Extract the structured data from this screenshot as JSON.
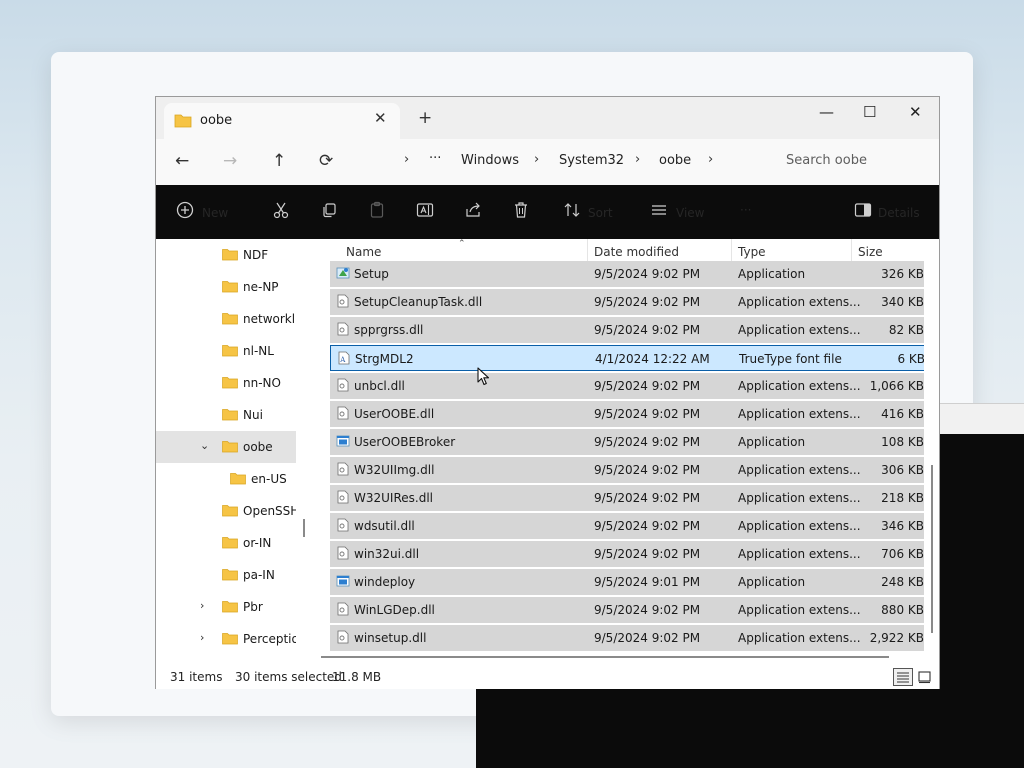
{
  "window": {
    "tab_title": "oobe",
    "tab_close": "✕",
    "new_tab": "+",
    "minimize": "—",
    "maximize": "☐",
    "close": "✕"
  },
  "addressbar": {
    "back": "←",
    "forward": "→",
    "up": "↑",
    "refresh": "⟳",
    "ellipsis": "···",
    "breadcrumbs": [
      "Windows",
      "System32",
      "oobe"
    ],
    "sep": "›",
    "search_placeholder": "Search oobe"
  },
  "toolbar": {
    "new_label": "New",
    "sort_label": "Sort",
    "view_label": "View",
    "more": "···",
    "details_label": "Details"
  },
  "sidebar": {
    "items": [
      {
        "label": "NDF",
        "chevron": "",
        "indent": 1,
        "selected": false
      },
      {
        "label": "ne-NP",
        "chevron": "",
        "indent": 1,
        "selected": false
      },
      {
        "label": "networklist",
        "chevron": "",
        "indent": 1,
        "selected": false
      },
      {
        "label": "nl-NL",
        "chevron": "",
        "indent": 1,
        "selected": false
      },
      {
        "label": "nn-NO",
        "chevron": "",
        "indent": 1,
        "selected": false
      },
      {
        "label": "Nui",
        "chevron": "",
        "indent": 1,
        "selected": false
      },
      {
        "label": "oobe",
        "chevron": "⌄",
        "indent": 1,
        "selected": true
      },
      {
        "label": "en-US",
        "chevron": "",
        "indent": 2,
        "selected": false
      },
      {
        "label": "OpenSSH",
        "chevron": "",
        "indent": 1,
        "selected": false
      },
      {
        "label": "or-IN",
        "chevron": "",
        "indent": 1,
        "selected": false
      },
      {
        "label": "pa-IN",
        "chevron": "",
        "indent": 1,
        "selected": false
      },
      {
        "label": "Pbr",
        "chevron": "›",
        "indent": 1,
        "selected": false
      },
      {
        "label": "Perception",
        "chevron": "›",
        "indent": 1,
        "selected": false
      }
    ]
  },
  "columns": {
    "name": "Name",
    "date": "Date modified",
    "type": "Type",
    "size": "Size"
  },
  "files": [
    {
      "name": "Setup",
      "date": "9/5/2024 9:02 PM",
      "type": "Application",
      "size": "326 KB",
      "icon": "setup-icon",
      "focused": false
    },
    {
      "name": "SetupCleanupTask.dll",
      "date": "9/5/2024 9:02 PM",
      "type": "Application extens...",
      "size": "340 KB",
      "icon": "dll-icon",
      "focused": false
    },
    {
      "name": "spprgrss.dll",
      "date": "9/5/2024 9:02 PM",
      "type": "Application extens...",
      "size": "82 KB",
      "icon": "dll-icon",
      "focused": false
    },
    {
      "name": "StrgMDL2",
      "date": "4/1/2024 12:22 AM",
      "type": "TrueType font file",
      "size": "6 KB",
      "icon": "font-icon",
      "focused": true
    },
    {
      "name": "unbcl.dll",
      "date": "9/5/2024 9:02 PM",
      "type": "Application extens...",
      "size": "1,066 KB",
      "icon": "dll-icon",
      "focused": false
    },
    {
      "name": "UserOOBE.dll",
      "date": "9/5/2024 9:02 PM",
      "type": "Application extens...",
      "size": "416 KB",
      "icon": "dll-icon",
      "focused": false
    },
    {
      "name": "UserOOBEBroker",
      "date": "9/5/2024 9:02 PM",
      "type": "Application",
      "size": "108 KB",
      "icon": "app-icon",
      "focused": false
    },
    {
      "name": "W32UIImg.dll",
      "date": "9/5/2024 9:02 PM",
      "type": "Application extens...",
      "size": "306 KB",
      "icon": "dll-icon",
      "focused": false
    },
    {
      "name": "W32UIRes.dll",
      "date": "9/5/2024 9:02 PM",
      "type": "Application extens...",
      "size": "218 KB",
      "icon": "dll-icon",
      "focused": false
    },
    {
      "name": "wdsutil.dll",
      "date": "9/5/2024 9:02 PM",
      "type": "Application extens...",
      "size": "346 KB",
      "icon": "dll-icon",
      "focused": false
    },
    {
      "name": "win32ui.dll",
      "date": "9/5/2024 9:02 PM",
      "type": "Application extens...",
      "size": "706 KB",
      "icon": "dll-icon",
      "focused": false
    },
    {
      "name": "windeploy",
      "date": "9/5/2024 9:01 PM",
      "type": "Application",
      "size": "248 KB",
      "icon": "app-icon",
      "focused": false
    },
    {
      "name": "WinLGDep.dll",
      "date": "9/5/2024 9:02 PM",
      "type": "Application extens...",
      "size": "880 KB",
      "icon": "dll-icon",
      "focused": false
    },
    {
      "name": "winsetup.dll",
      "date": "9/5/2024 9:02 PM",
      "type": "Application extens...",
      "size": "2,922 KB",
      "icon": "dll-icon",
      "focused": false
    }
  ],
  "status": {
    "item_count": "31 items",
    "selected": "30 items selected",
    "size": "11.8 MB"
  },
  "colors": {
    "toolbar_bg": "#0c0c0c",
    "selection_gray": "#d6d6d6",
    "focus_blue": "#cce8ff",
    "focus_border": "#0a5fa8",
    "folder_yellow": "#f6c445"
  }
}
